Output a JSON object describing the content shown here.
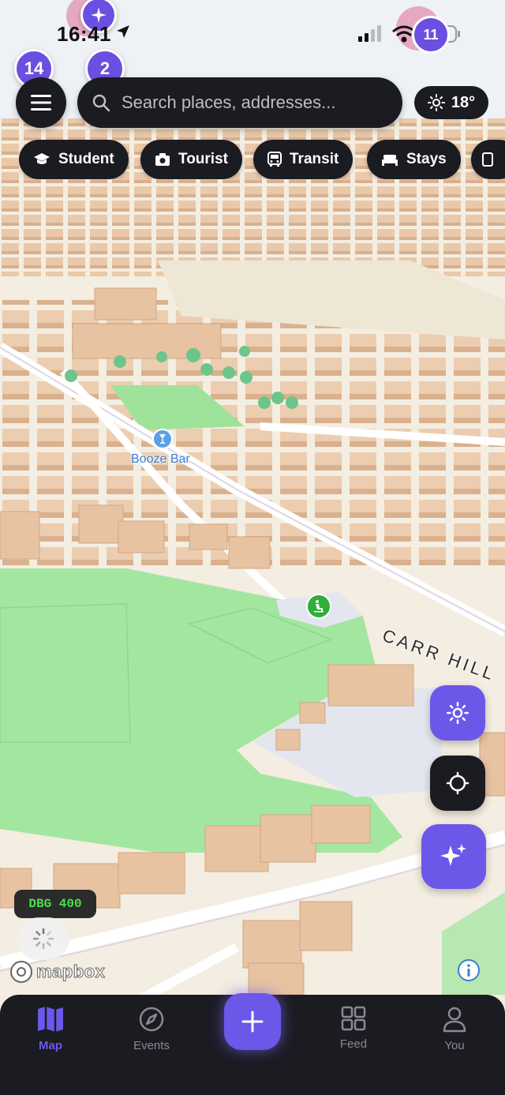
{
  "status_bar": {
    "time": "16:41",
    "battery": "11"
  },
  "clusters": {
    "left_count": "14",
    "middle_count": "2"
  },
  "search": {
    "placeholder": "Search places, addresses..."
  },
  "weather": {
    "temperature": "18°",
    "icon": "sun-icon"
  },
  "filter_chips": [
    {
      "label": "Student",
      "icon": "graduation-cap-icon"
    },
    {
      "label": "Tourist",
      "icon": "camera-icon"
    },
    {
      "label": "Transit",
      "icon": "bus-icon"
    },
    {
      "label": "Stays",
      "icon": "bed-icon"
    }
  ],
  "map": {
    "poi_label": "Booze Bar",
    "road_label": "CARR HILL",
    "attribution": "mapbox",
    "colors": {
      "land": "#f3ece0",
      "park": "#a8e6a0",
      "building": "#e7c7a8",
      "accent": "#6b57e8"
    }
  },
  "debug_badge": "DBG 400",
  "tab_bar": {
    "tabs": [
      {
        "label": "Map",
        "icon": "map-icon",
        "active": true
      },
      {
        "label": "Events",
        "icon": "compass-icon",
        "active": false
      },
      {
        "label": "Feed",
        "icon": "grid-icon",
        "active": false
      },
      {
        "label": "You",
        "icon": "person-icon",
        "active": false
      }
    ],
    "add_icon": "plus-icon"
  }
}
